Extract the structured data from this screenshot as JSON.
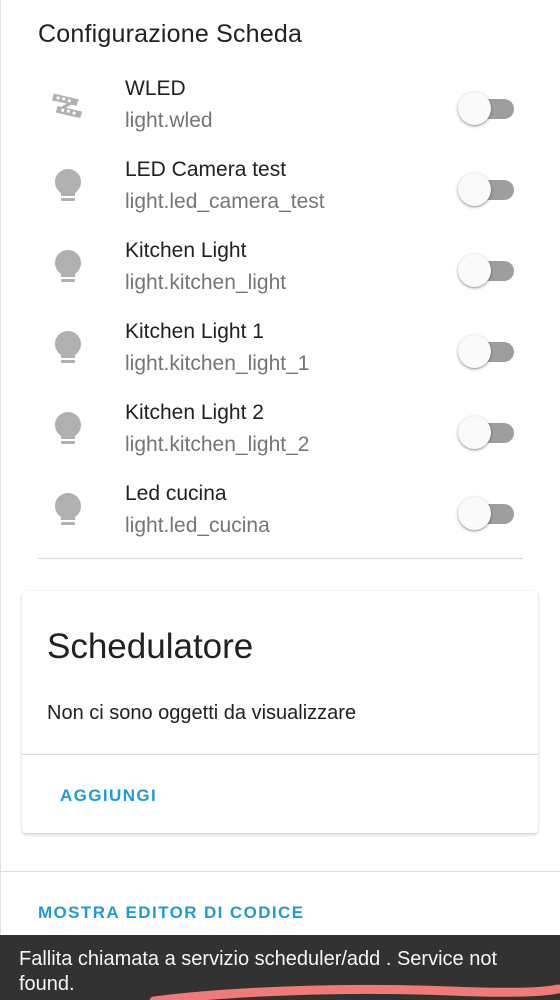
{
  "section": {
    "title": "Configurazione Scheda"
  },
  "entities": [
    {
      "name": "WLED",
      "entity_id": "light.wled",
      "icon": "led-strip-icon",
      "state": "off"
    },
    {
      "name": "LED Camera test",
      "entity_id": "light.led_camera_test",
      "icon": "lightbulb-icon",
      "state": "off"
    },
    {
      "name": "Kitchen Light",
      "entity_id": "light.kitchen_light",
      "icon": "lightbulb-icon",
      "state": "off"
    },
    {
      "name": "Kitchen Light 1",
      "entity_id": "light.kitchen_light_1",
      "icon": "lightbulb-icon",
      "state": "off"
    },
    {
      "name": "Kitchen Light 2",
      "entity_id": "light.kitchen_light_2",
      "icon": "lightbulb-icon",
      "state": "off"
    },
    {
      "name": "Led cucina",
      "entity_id": "light.led_cucina",
      "icon": "lightbulb-icon",
      "state": "off"
    }
  ],
  "scheduler_card": {
    "title": "Schedulatore",
    "empty_message": "Non ci sono oggetti da visualizzare",
    "add_label": "AGGIUNGI"
  },
  "footer": {
    "code_editor_label": "MOSTRA EDITOR DI CODICE"
  },
  "snackbar": {
    "message": "Fallita chiamata a servizio scheduler/add . Service not found."
  },
  "colors": {
    "accent": "#1e9bd7",
    "icon": "#b0b0b0",
    "toggle_track_off": "#9e9e9e",
    "snackbar_bg": "#323232",
    "underline": "#f07a7a"
  }
}
